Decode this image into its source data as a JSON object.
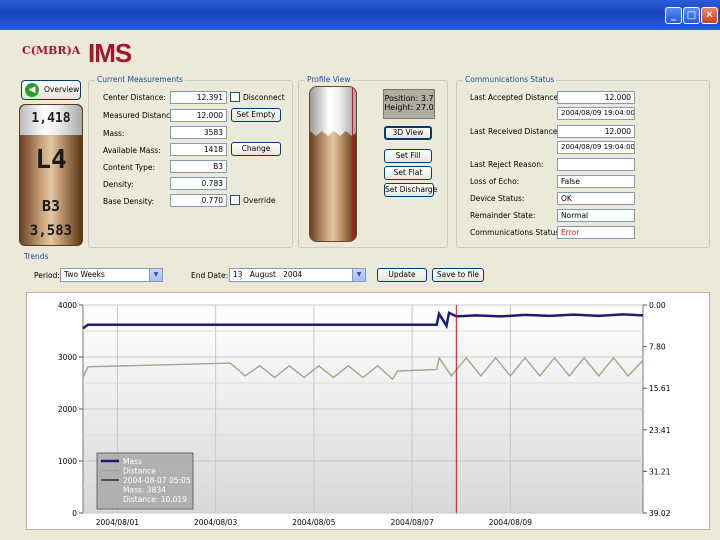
{
  "window": {
    "minimize": "_",
    "maximize": "□",
    "close": "✕"
  },
  "logo": {
    "brand": "C(MBR)A",
    "product": "IMS"
  },
  "overview": {
    "button": "Overview",
    "top_value": "1,418",
    "tank_id": "L4",
    "content": "B3",
    "bottom_value": "3,583"
  },
  "current": {
    "title": "Current Measurements",
    "rows": [
      {
        "label": "Center Distance:",
        "value": "12.391"
      },
      {
        "label": "Measured Distance:",
        "value": "12.000"
      },
      {
        "label": "Mass:",
        "value": "3583"
      },
      {
        "label": "Available Mass:",
        "value": "1418"
      },
      {
        "label": "Content Type:",
        "value": "B3"
      },
      {
        "label": "Density:",
        "value": "0.783"
      },
      {
        "label": "Base Density:",
        "value": "0.770"
      }
    ],
    "disconnect": "Disconnect",
    "set_empty": "Set Empty",
    "change": "Change",
    "override": "Override"
  },
  "profile": {
    "title": "Profile View",
    "position": "Position: 3.7",
    "height": "Height: 27.0",
    "view3d": "3D View",
    "set_fill": "Set Fill",
    "set_flat": "Set Flat",
    "set_discharge": "Set Discharge"
  },
  "comms": {
    "title": "Communications Status",
    "last_accepted_label": "Last Accepted Distance:",
    "last_accepted_value": "12.000",
    "last_accepted_time": "2004/08/09 19:04:00",
    "last_received_label": "Last Received Distance:",
    "last_received_value": "12.000",
    "last_received_time": "2004/08/09 19:04:00",
    "reject_label": "Last Reject Reason:",
    "reject_value": "",
    "echo_label": "Loss of Echo:",
    "echo_value": "False",
    "device_label": "Device Status:",
    "device_value": "OK",
    "remainder_label": "Remainder State:",
    "remainder_value": "Normal",
    "status_label": "Communications Status:",
    "status_value": "Error"
  },
  "trends": {
    "title": "Trends",
    "period_label": "Period:",
    "period_value": "Two Weeks",
    "end_label": "End Date:",
    "end_value": "13   August   2004",
    "update": "Update",
    "save": "Save to file"
  },
  "chart_data": {
    "type": "line",
    "x_ticks": [
      "2004/08/01",
      "2004/08/03",
      "2004/08/05",
      "2004/08/07",
      "2004/08/09"
    ],
    "y_left_ticks": [
      "4000",
      "3000",
      "2000",
      "1000",
      "0"
    ],
    "y_left_range": [
      0,
      4000
    ],
    "y_right_ticks": [
      "0.00",
      "7.80",
      "15.61",
      "23.41",
      "31.21",
      "39.02"
    ],
    "y_right_range": [
      0,
      39.02
    ],
    "x_range_days": [
      0,
      11.4
    ],
    "series": [
      {
        "name": "Mass",
        "axis": "left",
        "color": "#1a1f6e",
        "points": [
          [
            0,
            3550
          ],
          [
            0.1,
            3620
          ],
          [
            7.2,
            3620
          ],
          [
            7.25,
            3830
          ],
          [
            7.4,
            3600
          ],
          [
            7.45,
            3850
          ],
          [
            7.6,
            3780
          ],
          [
            8,
            3800
          ],
          [
            8.5,
            3780
          ],
          [
            9,
            3810
          ],
          [
            9.5,
            3790
          ],
          [
            10,
            3815
          ],
          [
            10.5,
            3790
          ],
          [
            11,
            3820
          ],
          [
            11.4,
            3800
          ]
        ]
      },
      {
        "name": "Distance",
        "axis": "right",
        "color": "#a4a487",
        "points": [
          [
            0,
            13.6
          ],
          [
            0.1,
            11.6
          ],
          [
            3,
            10.9
          ],
          [
            3.3,
            13.3
          ],
          [
            3.6,
            11.4
          ],
          [
            3.9,
            13.6
          ],
          [
            4.2,
            11.4
          ],
          [
            4.5,
            13.6
          ],
          [
            4.8,
            11.4
          ],
          [
            5.1,
            13.6
          ],
          [
            5.4,
            11.4
          ],
          [
            5.7,
            13.6
          ],
          [
            6,
            11.4
          ],
          [
            6.3,
            13.9
          ],
          [
            6.4,
            12.4
          ],
          [
            7.2,
            12.1
          ],
          [
            7.25,
            9.9
          ],
          [
            7.5,
            13.3
          ],
          [
            7.8,
            9.9
          ],
          [
            8.1,
            13.3
          ],
          [
            8.4,
            9.9
          ],
          [
            8.7,
            13.3
          ],
          [
            9,
            9.9
          ],
          [
            9.3,
            13.3
          ],
          [
            9.6,
            9.9
          ],
          [
            9.9,
            13.3
          ],
          [
            10.2,
            9.9
          ],
          [
            10.5,
            13.3
          ],
          [
            10.8,
            9.9
          ],
          [
            11.1,
            13.3
          ],
          [
            11.4,
            10.4
          ]
        ]
      }
    ],
    "cursor_x": 7.6,
    "legend": {
      "time": "2004-08-07 05:05",
      "mass": "Mass: 3834",
      "distance": "Distance: 10.019"
    },
    "grid": true,
    "legend_position": "bottom-left"
  }
}
